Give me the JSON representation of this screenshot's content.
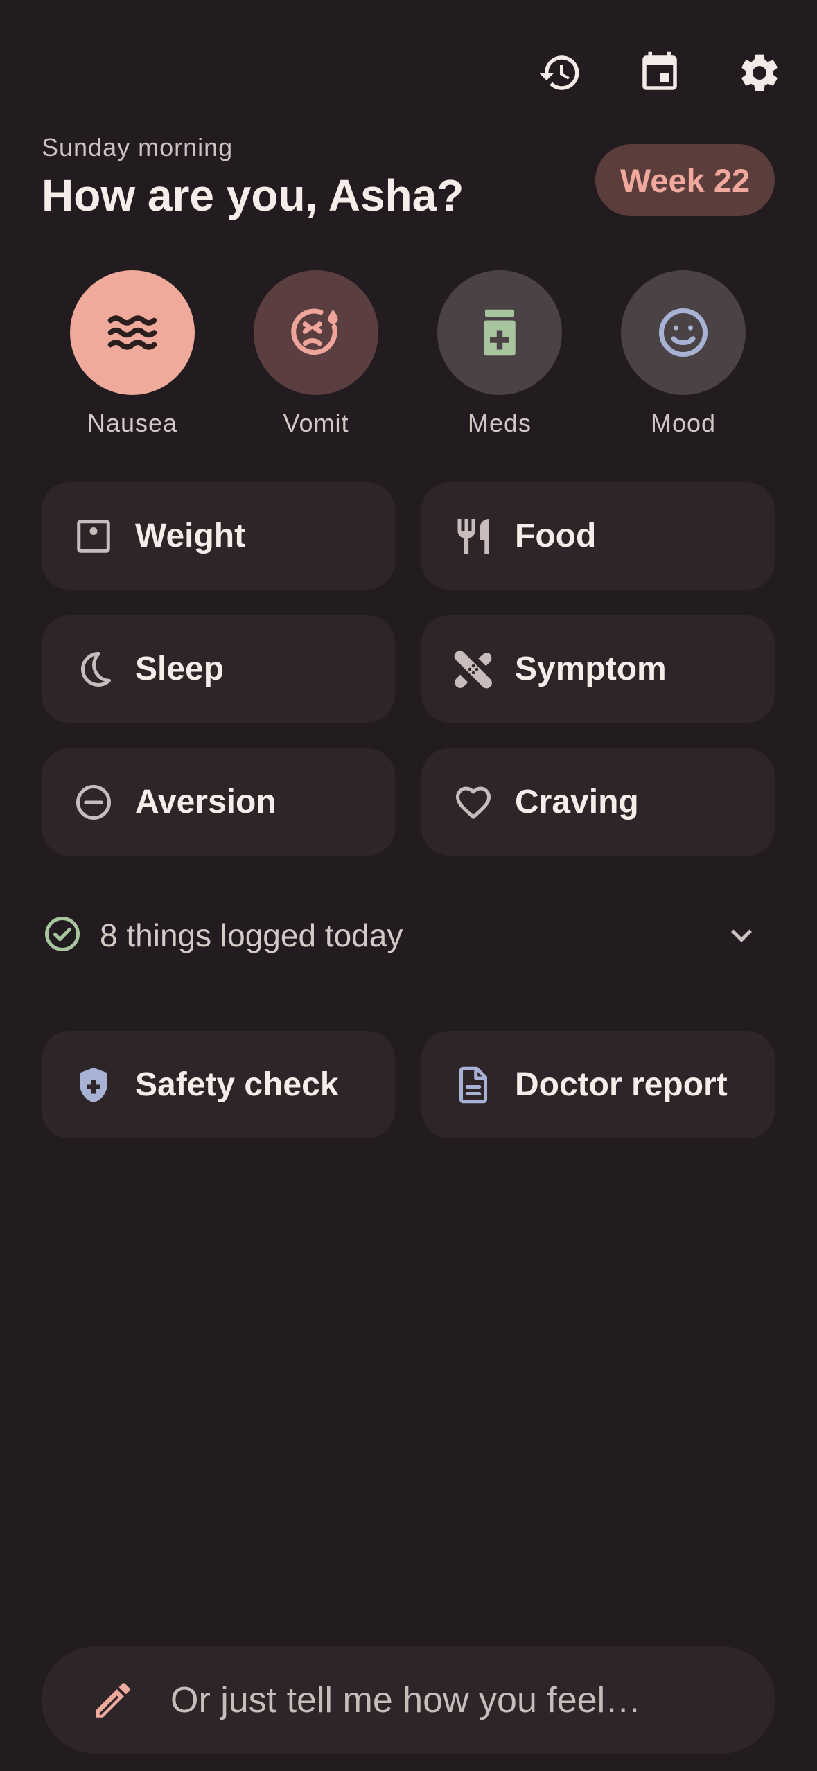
{
  "toolbar": {
    "icons": [
      "history-icon",
      "calendar-icon",
      "settings-icon"
    ]
  },
  "header": {
    "subtitle": "Sunday morning",
    "title": "How are you, Asha?",
    "week_badge": "Week 22"
  },
  "quick_actions": [
    {
      "label": "Nausea",
      "icon": "waves-icon",
      "bg": "#efaa9c",
      "fg": "#2b1e1f"
    },
    {
      "label": "Vomit",
      "icon": "sick-face-icon",
      "bg": "#5b3f40",
      "fg": "#f0a59a"
    },
    {
      "label": "Meds",
      "icon": "medication-icon",
      "bg": "#4a4245",
      "fg": "#a8c5a0"
    },
    {
      "label": "Mood",
      "icon": "smiley-icon",
      "bg": "#4a4245",
      "fg": "#a7b2d4"
    }
  ],
  "log_cards": [
    {
      "label": "Weight",
      "icon": "scale-icon"
    },
    {
      "label": "Food",
      "icon": "fork-knife-icon"
    },
    {
      "label": "Sleep",
      "icon": "moon-icon"
    },
    {
      "label": "Symptom",
      "icon": "bandage-icon"
    },
    {
      "label": "Aversion",
      "icon": "minus-circle-icon"
    },
    {
      "label": "Craving",
      "icon": "heart-icon"
    }
  ],
  "logged": {
    "text": "8 things logged today"
  },
  "tools": [
    {
      "label": "Safety check",
      "icon": "shield-plus-icon"
    },
    {
      "label": "Doctor report",
      "icon": "document-icon"
    }
  ],
  "ask": {
    "placeholder": "Or just tell me how you feel…"
  },
  "colors": {
    "background": "#221b20",
    "card": "#2e2528",
    "accent": "#efaa9c",
    "success": "#a8c5a0"
  }
}
